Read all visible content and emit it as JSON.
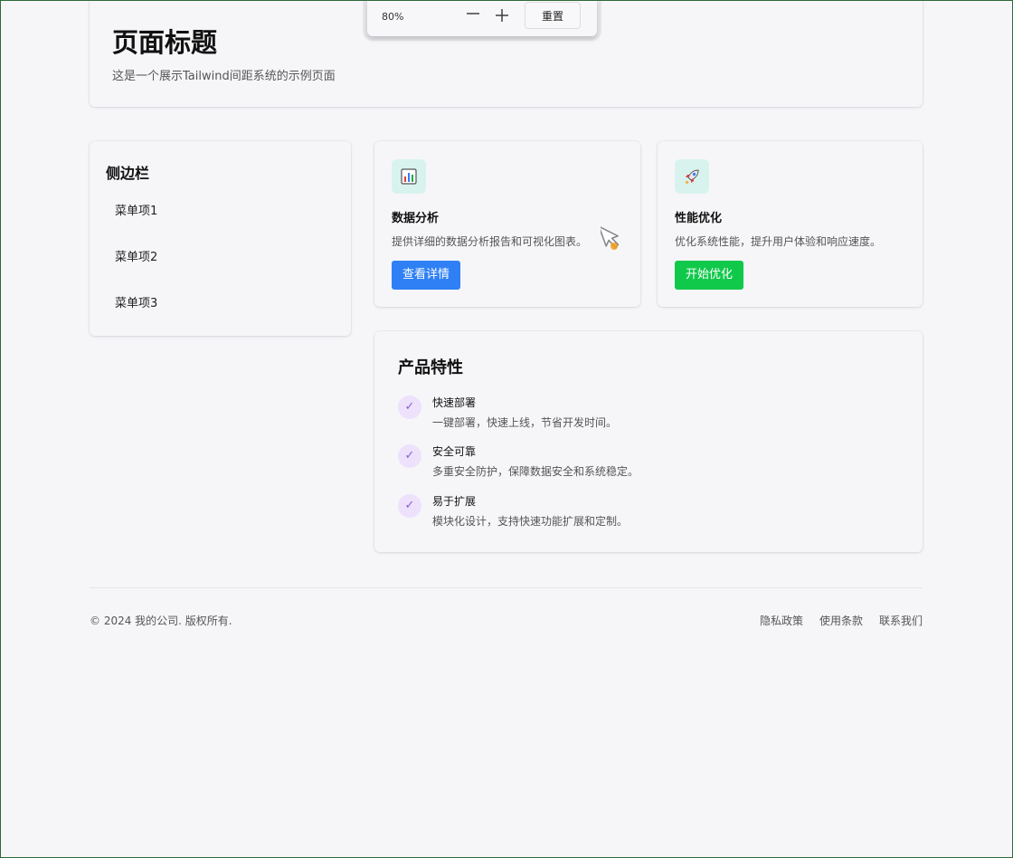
{
  "header": {
    "title": "页面标题",
    "subtitle": "这是一个展示Tailwind间距系统的示例页面"
  },
  "zoom_toolbar": {
    "level": "80%",
    "zoom_out_icon": "minus-icon",
    "zoom_in_icon": "plus-icon",
    "reset_label": "重置"
  },
  "sidebar": {
    "title": "侧边栏",
    "items": [
      {
        "label": "菜单项1"
      },
      {
        "label": "菜单项2"
      },
      {
        "label": "菜单项3"
      }
    ]
  },
  "features": [
    {
      "icon": "bar-chart-icon",
      "title": "数据分析",
      "description": "提供详细的数据分析报告和可视化图表。",
      "button_label": "查看详情",
      "button_color": "#2f80f5"
    },
    {
      "icon": "rocket-icon",
      "title": "性能优化",
      "description": "优化系统性能，提升用户体验和响应速度。",
      "button_label": "开始优化",
      "button_color": "#10c94a"
    }
  ],
  "product": {
    "title": "产品特性",
    "check_icon": "check-icon",
    "items": [
      {
        "title": "快速部署",
        "description": "一键部署，快速上线，节省开发时间。"
      },
      {
        "title": "安全可靠",
        "description": "多重安全防护，保障数据安全和系统稳定。"
      },
      {
        "title": "易于扩展",
        "description": "模块化设计，支持快速功能扩展和定制。"
      }
    ]
  },
  "footer": {
    "copyright": "© 2024 我的公司. 版权所有.",
    "links": [
      {
        "label": "隐私政策"
      },
      {
        "label": "使用条款"
      },
      {
        "label": "联系我们"
      }
    ]
  },
  "colors": {
    "page_background": "#f6f6f9",
    "feature_icon_bg": "#d8f3ee",
    "check_bg": "#ede1fb",
    "check_color": "#8e5ed0"
  }
}
